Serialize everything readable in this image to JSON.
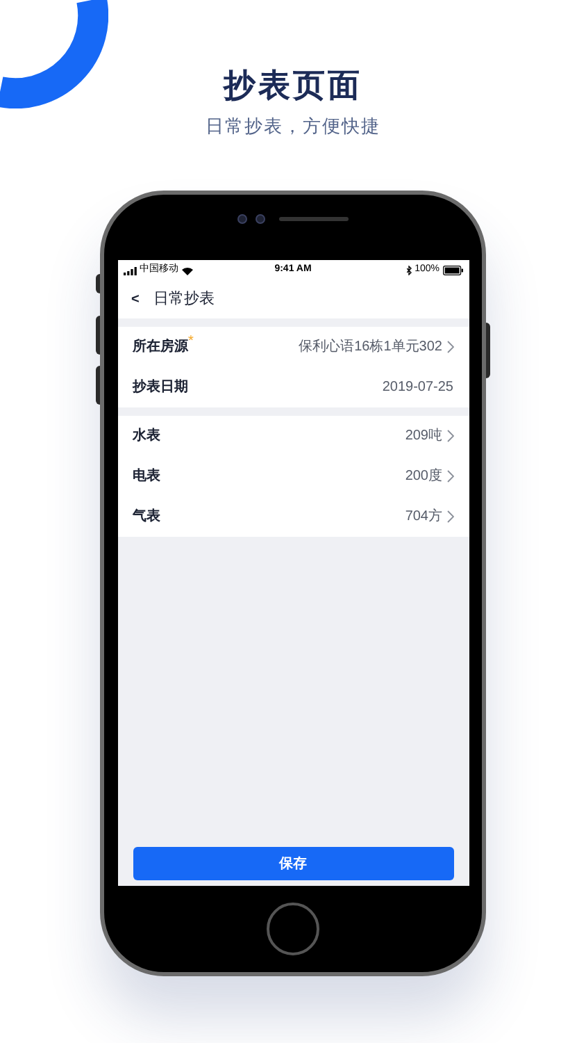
{
  "header": {
    "title": "抄表页面",
    "subtitle": "日常抄表，方便快捷"
  },
  "status_bar": {
    "carrier": "中国移动",
    "time": "9:41 AM",
    "battery": "100%"
  },
  "nav": {
    "back": "<",
    "title": "日常抄表"
  },
  "groups": [
    {
      "rows": [
        {
          "label": "所在房源",
          "required_mark": "*",
          "value": "保利心语16栋1单元302",
          "chevron": true
        },
        {
          "label": "抄表日期",
          "value": "2019-07-25",
          "chevron": false
        }
      ]
    },
    {
      "rows": [
        {
          "label": "水表",
          "value": "209吨",
          "chevron": true
        },
        {
          "label": "电表",
          "value": "200度",
          "chevron": true
        },
        {
          "label": "气表",
          "value": "704方",
          "chevron": true
        }
      ]
    }
  ],
  "save_button": "保存"
}
